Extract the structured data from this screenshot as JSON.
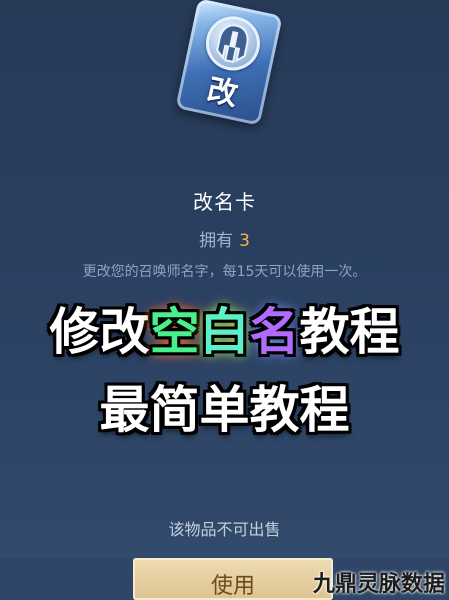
{
  "item": {
    "card_char": "改",
    "name": "改名卡",
    "owned_label": "拥有",
    "owned_count": "3",
    "description": "更改您的召唤师名字，每15天可以使用一次。"
  },
  "overlay": {
    "line1_a": "修改",
    "line1_b": "空",
    "line1_c": "白",
    "line1_d": "名",
    "line1_e": "教程",
    "line2": "最简单教程"
  },
  "footer": {
    "note": "该物品不可出售",
    "use_button": "使用"
  },
  "watermark": "九鼎灵脉数据",
  "colors": {
    "owned_count": "#f2b642",
    "button_bg": "#dcc28f",
    "background": "#2a3f60"
  },
  "icons": {
    "card_emblem": "helmet-icon"
  }
}
